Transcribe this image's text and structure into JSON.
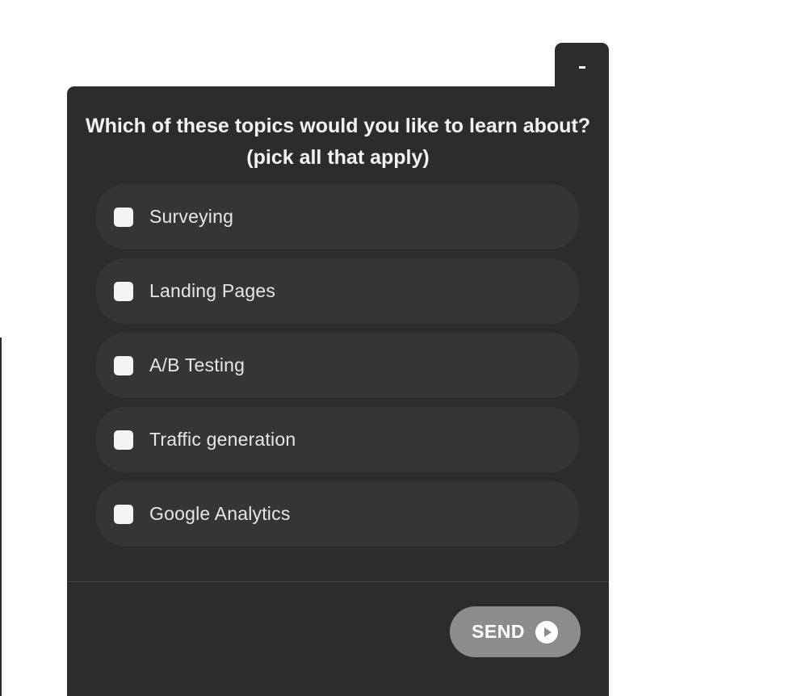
{
  "widget": {
    "minimize_label": "-",
    "question": "Which of these topics would you like to learn about? (pick all that apply)",
    "options": [
      {
        "label": "Surveying",
        "checked": false
      },
      {
        "label": "Landing Pages",
        "checked": false
      },
      {
        "label": "A/B Testing",
        "checked": false
      },
      {
        "label": "Traffic generation",
        "checked": false
      },
      {
        "label": "Google Analytics",
        "checked": false
      }
    ],
    "send_label": "SEND",
    "send_icon": "play-circle-icon"
  },
  "colors": {
    "panel_background": "#2c2c2c",
    "option_background": "#353535",
    "send_button": "#8c8c8c",
    "text": "#f2f2f2"
  }
}
